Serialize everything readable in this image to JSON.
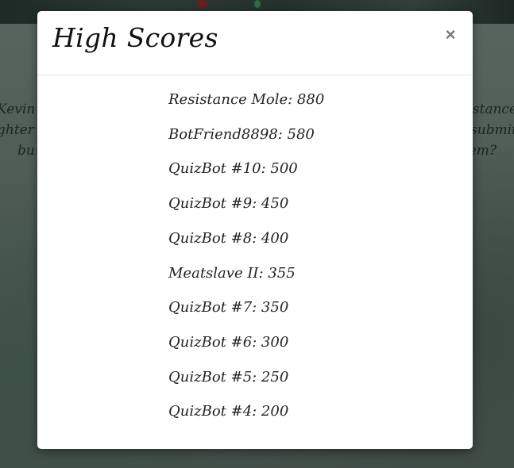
{
  "background": {
    "left_text": [
      "Kevin",
      "ghter",
      "bu"
    ],
    "right_text": [
      "stance",
      "submit",
      "em?"
    ]
  },
  "modal": {
    "title": "High Scores",
    "close_label": "×",
    "scores": [
      "Resistance Mole: 880",
      "BotFriend8898: 580",
      "QuizBot #10: 500",
      "QuizBot #9: 450",
      "QuizBot #8: 400",
      "Meatslave II: 355",
      "QuizBot #7: 350",
      "QuizBot #6: 300",
      "QuizBot #5: 250",
      "QuizBot #4: 200"
    ]
  },
  "colors": {
    "modal_bg": "#ffffff",
    "overlay": "#4d5b54",
    "text": "#222222",
    "close": "#777777"
  }
}
